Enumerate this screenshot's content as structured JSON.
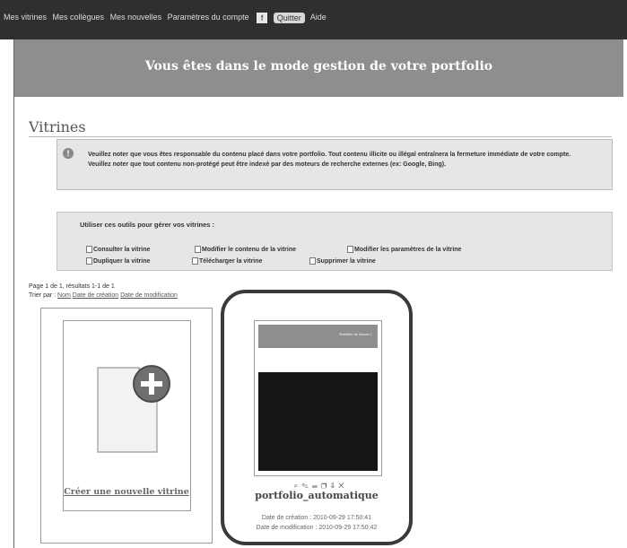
{
  "nav": {
    "items": [
      "Mes vitrines",
      "Mes collègues",
      "Mes nouvelles",
      "Paramètres du compte"
    ],
    "quit_label": "Quitter",
    "help_label": "Aide"
  },
  "banner": {
    "title": "Vous êtes dans le mode gestion de votre portfolio"
  },
  "section": {
    "title": "Vitrines"
  },
  "notice": {
    "line1": "Veuillez noter que vous êtes responsable du contenu placé dans votre portfolio. Tout contenu illicite ou illégal entraînera la fermeture immédiate de votre compte.",
    "line2": "Veuillez noter que tout contenu non-protégé peut être indexé par des moteurs de recherche externes (ex: Google, Bing)."
  },
  "tools": {
    "title": "Utiliser ces outils pour gérer vos vitrines :",
    "consult": "Consulter la vitrine",
    "modify_content": "Modifier le contenu de la vitrine",
    "modify_params": "Modifier les paramètres de la vitrine",
    "duplicate": "Dupliquer la vitrine",
    "download": "Télécharger la vitrine",
    "delete": "Supprimer la vitrine"
  },
  "results": {
    "summary": "Page 1 de 1, résultats 1-1 de 1",
    "sort_label": "Trier par :",
    "sort_name": "Nom",
    "sort_created": "Date de création",
    "sort_modified": "Date de modification"
  },
  "create_card": {
    "label": "Créer une nouvelle vitrine"
  },
  "portfolio": {
    "name": "portfolio_automatique",
    "thumb_header": "Portfolio de Simon C",
    "created": "Date de création : 2010-09-29 17:50:41",
    "modified": "Date de modification : 2010-09-29 17:50:42"
  }
}
